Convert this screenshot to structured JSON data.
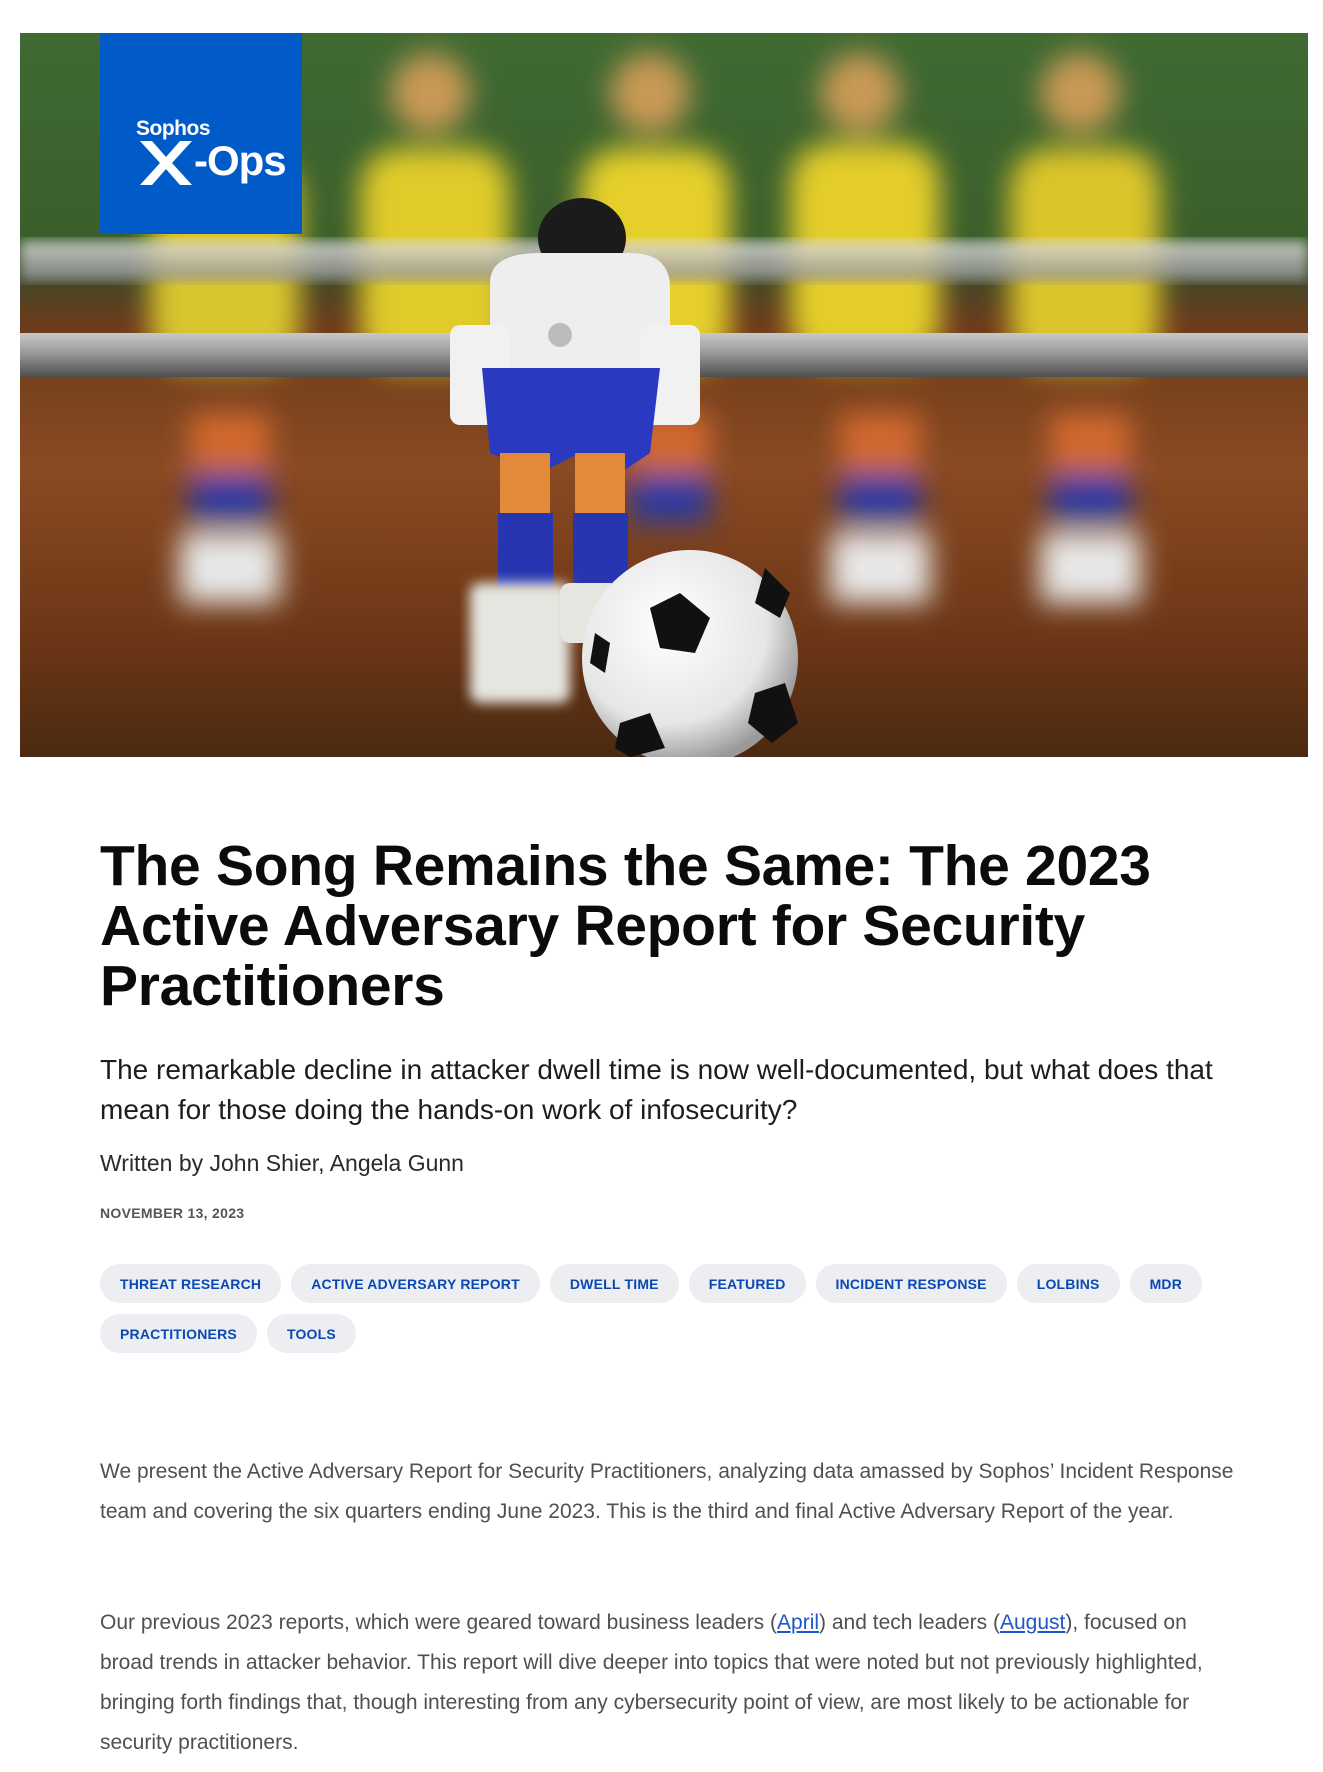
{
  "hero": {
    "logo": {
      "top": "Sophos",
      "ops": "-Ops"
    }
  },
  "article": {
    "title": "The Song Remains the Same: The 2023 Active Adversary Report for Security Practitioners",
    "subtitle": "The remarkable decline in attacker dwell time is now well-documented, but what does that mean for those doing the hands-on work of infosecurity?",
    "byline": "Written by John Shier, Angela Gunn",
    "date": "NOVEMBER 13, 2023",
    "tags": [
      "THREAT RESEARCH",
      "ACTIVE ADVERSARY REPORT",
      "DWELL TIME",
      "FEATURED",
      "INCIDENT RESPONSE",
      "LOLBINS",
      "MDR",
      "PRACTITIONERS",
      "TOOLS"
    ],
    "p1": "We present the Active Adversary Report for Security Practitioners, analyzing data amassed by Sophos’ Incident Response team and covering the six quarters ending June 2023. This is the third and final Active Adversary Report of the year.",
    "p2": {
      "before": "Our previous 2023 reports, which were geared toward business leaders (",
      "link1": "April",
      "middle": ") and tech leaders (",
      "link2": "August",
      "after": "), focused on broad trends in attacker behavior. This report will dive deeper into topics that were noted but not previously highlighted, bringing forth findings that, though interesting from any cybersecurity point of view, are most likely to be actionable for security practitioners."
    }
  }
}
